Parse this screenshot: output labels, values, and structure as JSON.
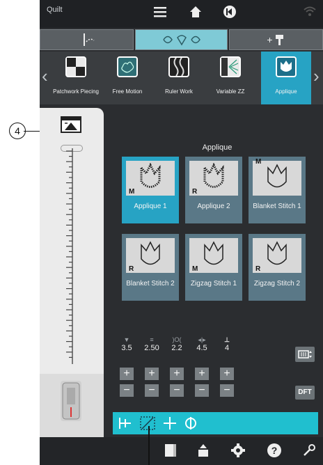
{
  "top_bar": {
    "mode_label": "Quilt",
    "icons": [
      "menu-icon",
      "home-icon",
      "back-icon",
      "wifi-icon"
    ]
  },
  "category_tabs": [
    {
      "name": "needle-tab-icon",
      "active": false
    },
    {
      "name": "decorative-tab-icon",
      "active": true
    },
    {
      "name": "plus-tab-icon",
      "active": false
    }
  ],
  "category_tab_plus_label": "+",
  "techniques": [
    {
      "label": "Patchwork Piecing"
    },
    {
      "label": "Free Motion"
    },
    {
      "label": "Ruler Work"
    },
    {
      "label": "Variable ZZ"
    },
    {
      "label": "Applique"
    }
  ],
  "section_title": "Applique",
  "stitches": [
    {
      "badge": "M",
      "label": "Applique 1",
      "active": true
    },
    {
      "badge": "R",
      "label": "Applique 2",
      "active": false
    },
    {
      "badge": "M",
      "label": "Blanket Stitch 1",
      "active": false
    },
    {
      "badge": "R",
      "label": "Blanket Stitch 2",
      "active": false
    },
    {
      "badge": "M",
      "label": "Zigzag Stitch 1",
      "active": false
    },
    {
      "badge": "R",
      "label": "Zigzag Stitch 2",
      "active": false
    }
  ],
  "params": [
    {
      "icon": "stitch-width-icon",
      "value": "3.5"
    },
    {
      "icon": "stitch-length-icon",
      "value": "2.50"
    },
    {
      "icon": "density-icon",
      "value": "2.2"
    },
    {
      "icon": "position-icon",
      "value": "4.5"
    },
    {
      "icon": "tension-icon",
      "value": "4"
    }
  ],
  "plus_label": "+",
  "minus_label": "−",
  "dft_label": "DFT",
  "foot_label": "F",
  "callout_number": "4",
  "colors": {
    "accent": "#27a3c4",
    "strip": "#20bfcf",
    "panel": "#ebebeb"
  }
}
